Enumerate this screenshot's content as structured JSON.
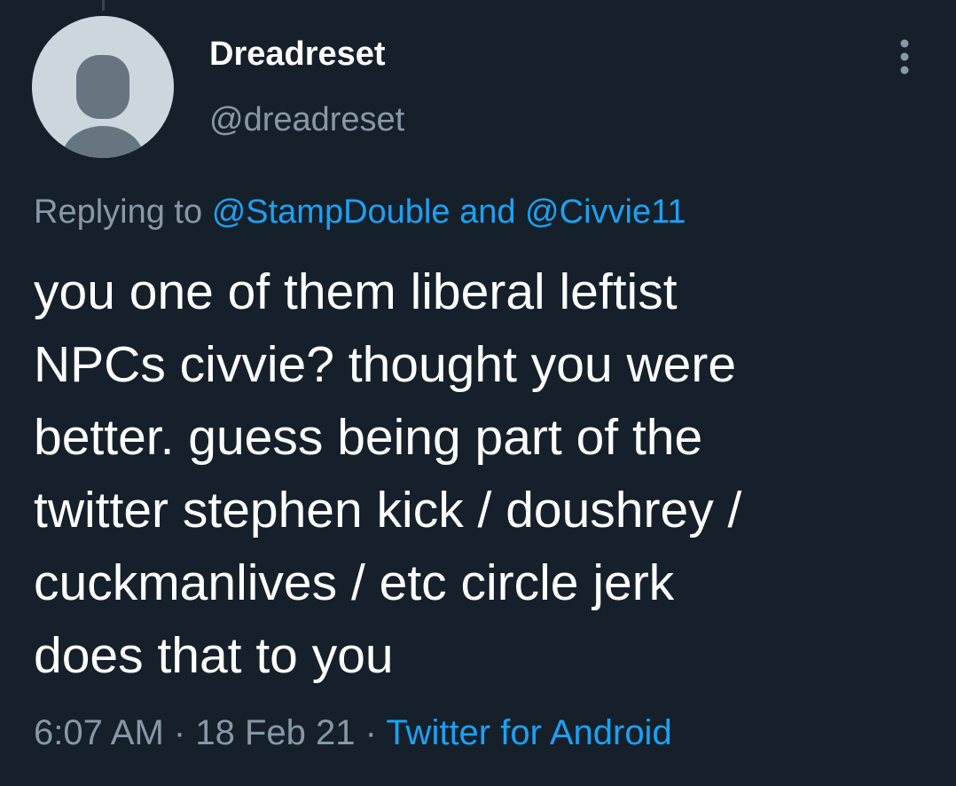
{
  "tweet": {
    "display_name": "Dreadreset",
    "handle": "@dreadreset",
    "replying_prefix": "Replying to",
    "replying_user_1": "@StampDouble",
    "replying_joiner": "and",
    "replying_user_2": "@Civvie11",
    "text": "you one of them liberal leftist\nNPCs civvie? thought you were\nbetter. guess being part of the\ntwitter stephen kick / doushrey /\ncuckmanlives / etc circle jerk\ndoes that to you",
    "time": "6:07 AM",
    "separator": "·",
    "date": "18 Feb 21",
    "source": "Twitter for Android"
  },
  "icons": {
    "avatar": "default-avatar-icon",
    "more": "more-vertical-icon"
  },
  "colors": {
    "background": "#15202b",
    "link": "#1da1f2",
    "secondary_text": "#8899a6",
    "primary_text": "#ffffff"
  }
}
